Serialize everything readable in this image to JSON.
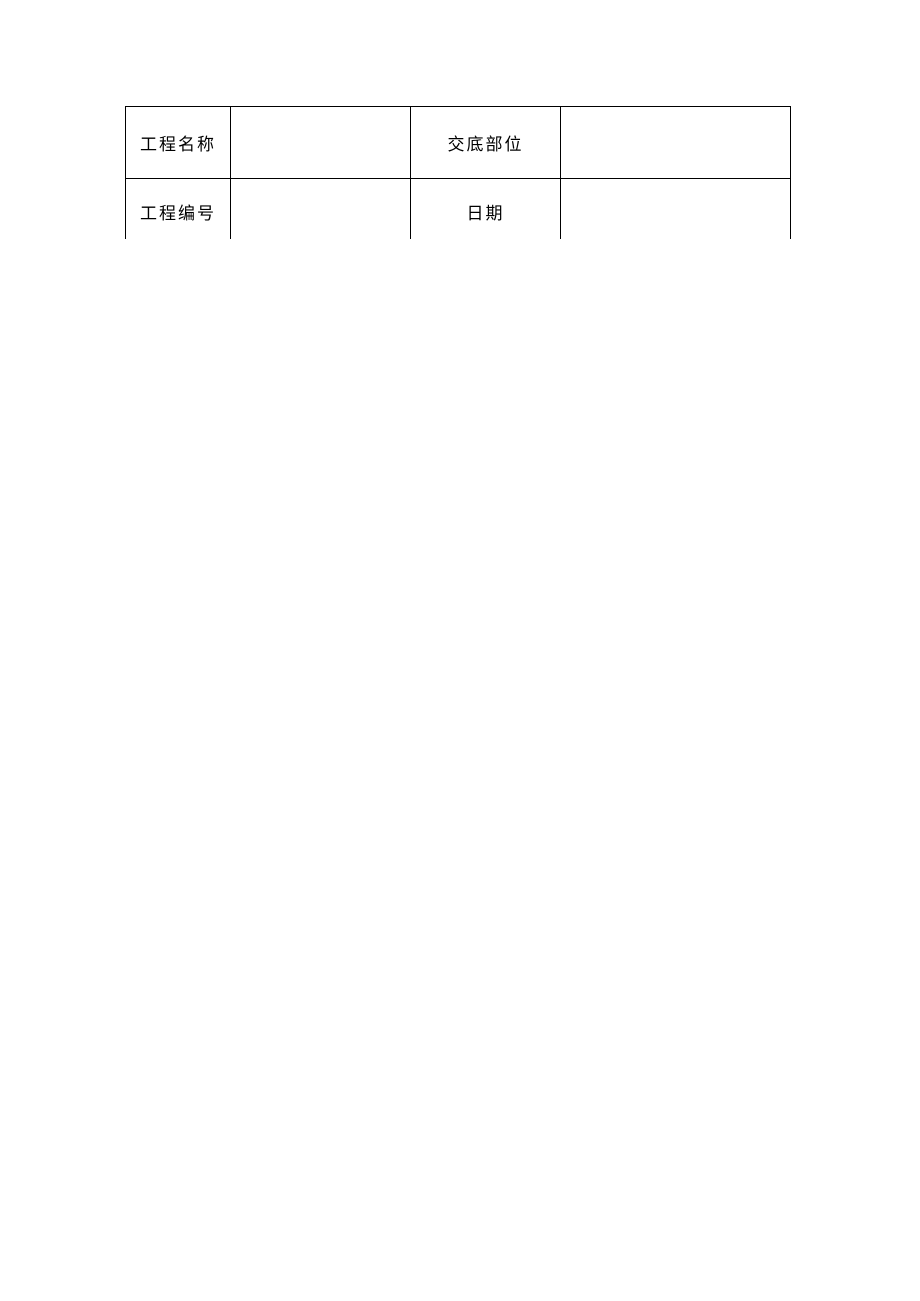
{
  "table": {
    "row1": {
      "label1": "工程名称",
      "value1": "",
      "label2": "交底部位",
      "value2": ""
    },
    "row2": {
      "label1": "工程编号",
      "value1": "",
      "label2": "日期",
      "value2": ""
    }
  }
}
